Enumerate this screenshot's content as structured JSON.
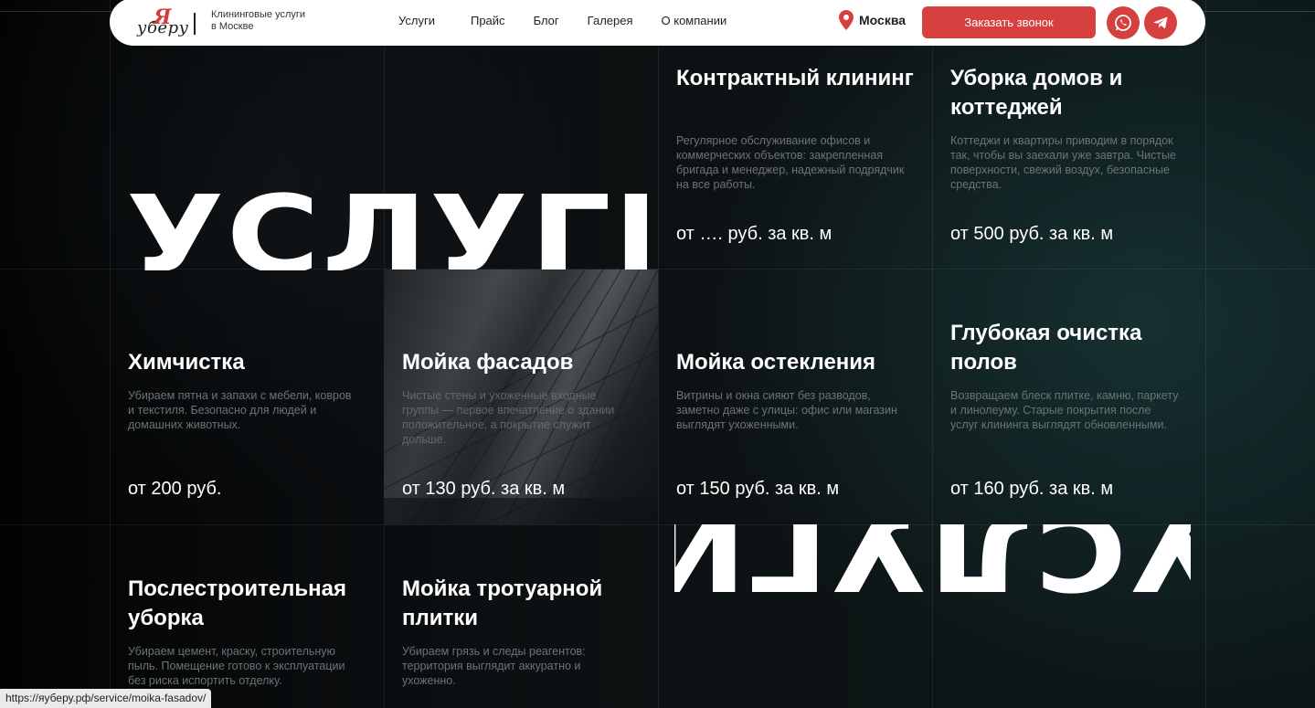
{
  "header": {
    "logo_ya": "Я",
    "logo_text": "уберу",
    "tagline": "Клининговые услуги в Москве",
    "nav": [
      "Услуги",
      "Прайс",
      "Блог",
      "Галерея",
      "О компании"
    ],
    "city": "Москва",
    "cta_label": "Заказать звонок",
    "social": [
      "whatsapp-icon",
      "telegram-icon"
    ],
    "accent_color": "#d6403e"
  },
  "hero": {
    "title": "УСЛУГИ",
    "title_mirrored": "УСЛУГИ"
  },
  "cards": [
    {
      "title": "Контрактный клининг",
      "desc": "Регулярное обслуживание офисов и коммерческих объектов: закрепленная бригада и менеджер, надежный подрядчик на все работы.",
      "price": "от …. руб. за кв. м"
    },
    {
      "title": "Уборка домов и коттеджей",
      "desc": "Коттеджи и квартиры приводим в порядок так, чтобы вы заехали уже завтра. Чистые поверхности, свежий воздух, безопасные средства.",
      "price": "от 500 руб. за кв. м"
    },
    {
      "title": "Химчистка",
      "desc": "Убираем пятна и запахи с мебели, ковров и текстиля. Безопасно для людей и домашних животных.",
      "price": "от 200 руб."
    },
    {
      "title": "Мойка фасадов",
      "desc": "Чистые стены и ухоженные входные группы — первое впечатление о здании положительное, а покрытие служит дольше.",
      "price": "от 130 руб. за кв. м"
    },
    {
      "title": "Мойка остекления",
      "desc": "Витрины и окна сияют без разводов, заметно даже с улицы: офис или магазин выглядят ухоженными.",
      "price": "от 150 руб. за кв. м"
    },
    {
      "title": "Глубокая очистка полов",
      "desc": "Возвращаем блеск плитке, камню, паркету и линолеуму. Старые покрытия после услуг клининга выглядят обновленными.",
      "price": "от 160 руб. за кв. м"
    },
    {
      "title": "Послестроительная уборка",
      "desc": "Убираем цемент, краску, строительную пыль. Помещение готово к эксплуатации без риска испортить отделку.",
      "price": ""
    },
    {
      "title": "Мойка тротуарной плитки",
      "desc": "Убираем грязь и следы реагентов: территория выглядит аккуратно и ухоженно.",
      "price": ""
    }
  ],
  "status_url": "https://яуберу.рф/service/moika-fasadov/"
}
